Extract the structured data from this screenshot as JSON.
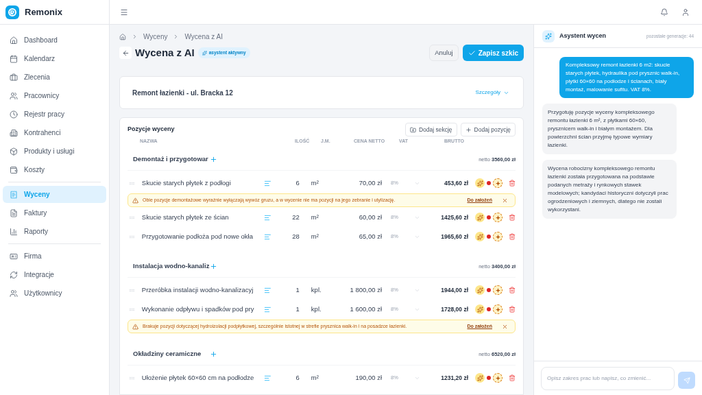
{
  "brand": {
    "name": "Remonix"
  },
  "sidebar": {
    "groups": [
      [
        {
          "label": "Dashboard",
          "selected": false
        },
        {
          "label": "Kalendarz",
          "selected": false
        },
        {
          "label": "Zlecenia",
          "selected": false
        },
        {
          "label": "Pracownicy",
          "selected": false
        },
        {
          "label": "Rejestr pracy",
          "selected": false
        },
        {
          "label": "Kontrahenci",
          "selected": false
        },
        {
          "label": "Produkty i usługi",
          "selected": false
        },
        {
          "label": "Koszty",
          "selected": false
        }
      ],
      [
        {
          "label": "Wyceny",
          "selected": true
        },
        {
          "label": "Faktury",
          "selected": false
        },
        {
          "label": "Raporty",
          "selected": false
        }
      ],
      [
        {
          "label": "Firma",
          "selected": false
        },
        {
          "label": "Integracje",
          "selected": false
        },
        {
          "label": "Użytkownicy",
          "selected": false
        }
      ]
    ]
  },
  "breadcrumb": [
    "Wyceny",
    "Wycena z AI"
  ],
  "page": {
    "title": "Wycena z AI",
    "badge": "asystent aktywny",
    "cancel": "Anuluj",
    "save": "Zapisz szkic"
  },
  "project": {
    "title": "Remont łazienki - ul. Bracka 12",
    "details": "Szczegóły"
  },
  "table": {
    "title": "Pozycje wyceny",
    "add_section": "Dodaj sekcję",
    "add_item": "Dodaj pozycję",
    "columns": [
      "NAZWA",
      "ILOŚĆ",
      "J.M.",
      "CENA NETTO",
      "VAT",
      "BRUTTO"
    ],
    "sections": [
      {
        "name": "Demontaż i przygotowar",
        "net_label": "netto",
        "net": "3560,00 zł",
        "rows": [
          {
            "kind": "item",
            "name": "Skucie starych płytek z podłogi",
            "qty": "6",
            "unit": "m²",
            "price": "70,00 zł",
            "vat": "8%",
            "gross": "453,60 zł"
          },
          {
            "kind": "warning",
            "text": "Obie pozycje demontażowe wyraźnie wyłączają wywóz gruzu, a w wycenie nie ma pozycji na jego zebranie i utylizację.",
            "link": "Do założeń"
          },
          {
            "kind": "item",
            "name": "Skucie starych płytek ze ścian",
            "qty": "22",
            "unit": "m²",
            "price": "60,00 zł",
            "vat": "8%",
            "gross": "1425,60 zł"
          },
          {
            "kind": "item",
            "name": "Przygotowanie podłoża pod nowe okła",
            "qty": "28",
            "unit": "m²",
            "price": "65,00 zł",
            "vat": "8%",
            "gross": "1965,60 zł"
          }
        ]
      },
      {
        "name": "Instalacja wodno-kanaliz",
        "net_label": "netto",
        "net": "3400,00 zł",
        "rows": [
          {
            "kind": "item",
            "name": "Przeróbka instalacji wodno-kanalizacyj",
            "qty": "1",
            "unit": "kpl.",
            "price": "1 800,00 zł",
            "vat": "8%",
            "gross": "1944,00 zł"
          },
          {
            "kind": "item",
            "name": "Wykonanie odpływu i spadków pod pry",
            "qty": "1",
            "unit": "kpl.",
            "price": "1 600,00 zł",
            "vat": "8%",
            "gross": "1728,00 zł"
          },
          {
            "kind": "warning",
            "text": "Brakuje pozycji dotyczącej hydroizolacji podpłytkowej, szczególnie istotnej w strefie prysznica walk-in i na posadzce łazienki.",
            "link": "Do założeń"
          }
        ]
      },
      {
        "name": "Okładziny ceramiczne",
        "net_label": "netto",
        "net": "6520,00 zł",
        "rows": [
          {
            "kind": "item",
            "name": "Ułożenie płytek 60×60 cm na podłodze",
            "qty": "6",
            "unit": "m²",
            "price": "190,00 zł",
            "vat": "8%",
            "gross": "1231,20 zł"
          }
        ]
      }
    ]
  },
  "assistant": {
    "title": "Asystent wycen",
    "quota": "pozostałe generacje: 44",
    "messages": [
      {
        "kind": "user",
        "text": "Kompleksowy remont łazienki 6 m2: skucie starych płytek, hydraulika pod prysznic walk-in, płytki 60×60 na podłodze i ścianach, biały montaż, malowanie sufitu. VAT 8%."
      },
      {
        "kind": "assistant",
        "text": "Przygotuję pozycje wyceny kompleksowego remontu łazienki 6 m², z płytkami 60×60, prysznicem walk-in i białym montażem. Dla powierzchni ścian przyjmę typowe wymiary łazienki."
      },
      {
        "kind": "assistant",
        "text": "Wycena robocizny kompleksowego remontu łazienki została przygotowana na podstawie podanych metraży i rynkowych stawek modelowych; kandydaci historyczni dotyczyli prac ogrodzeniowych i ziemnych, dlatego nie zostali wykorzystani."
      }
    ],
    "placeholder": "Opisz zakres prac lub napisz, co zmienić..."
  }
}
